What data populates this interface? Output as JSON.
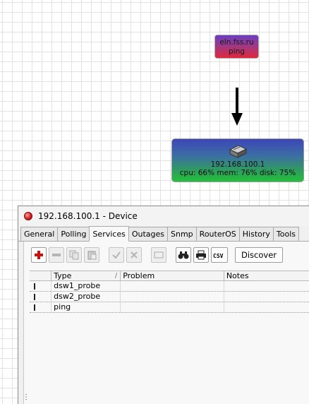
{
  "map": {
    "ping_node": {
      "host": "eln.fss.ru",
      "service": "ping",
      "colors": [
        "#6a3dc0",
        "#e0283a"
      ]
    },
    "device_node": {
      "icon": "router-icon",
      "ip": "192.168.100.1",
      "stats": "cpu: 66% mem: 76% disk: 75%",
      "colors": [
        "#3d46b8",
        "#22c13a"
      ]
    }
  },
  "window": {
    "title": "192.168.100.1 - Device",
    "tabs": [
      "General",
      "Polling",
      "Services",
      "Outages",
      "Snmp",
      "RouterOS",
      "History",
      "Tools"
    ],
    "active_tab": "Services",
    "toolbar": {
      "icons": [
        "add-icon",
        "remove-icon",
        "copy-icon",
        "paste-icon",
        "enable-icon",
        "disable-icon",
        "comment-icon",
        "find-icon",
        "print-icon",
        "csv-icon"
      ],
      "csv_label": "CSV",
      "discover_label": "Discover"
    },
    "table": {
      "columns": [
        "",
        "Type",
        "Problem",
        "Notes"
      ],
      "sort_glyph": "/",
      "rows": [
        {
          "type": "dsw1_probe",
          "problem": "",
          "notes": ""
        },
        {
          "type": "dsw2_probe",
          "problem": "",
          "notes": ""
        },
        {
          "type": "ping",
          "problem": "",
          "notes": ""
        }
      ]
    }
  }
}
